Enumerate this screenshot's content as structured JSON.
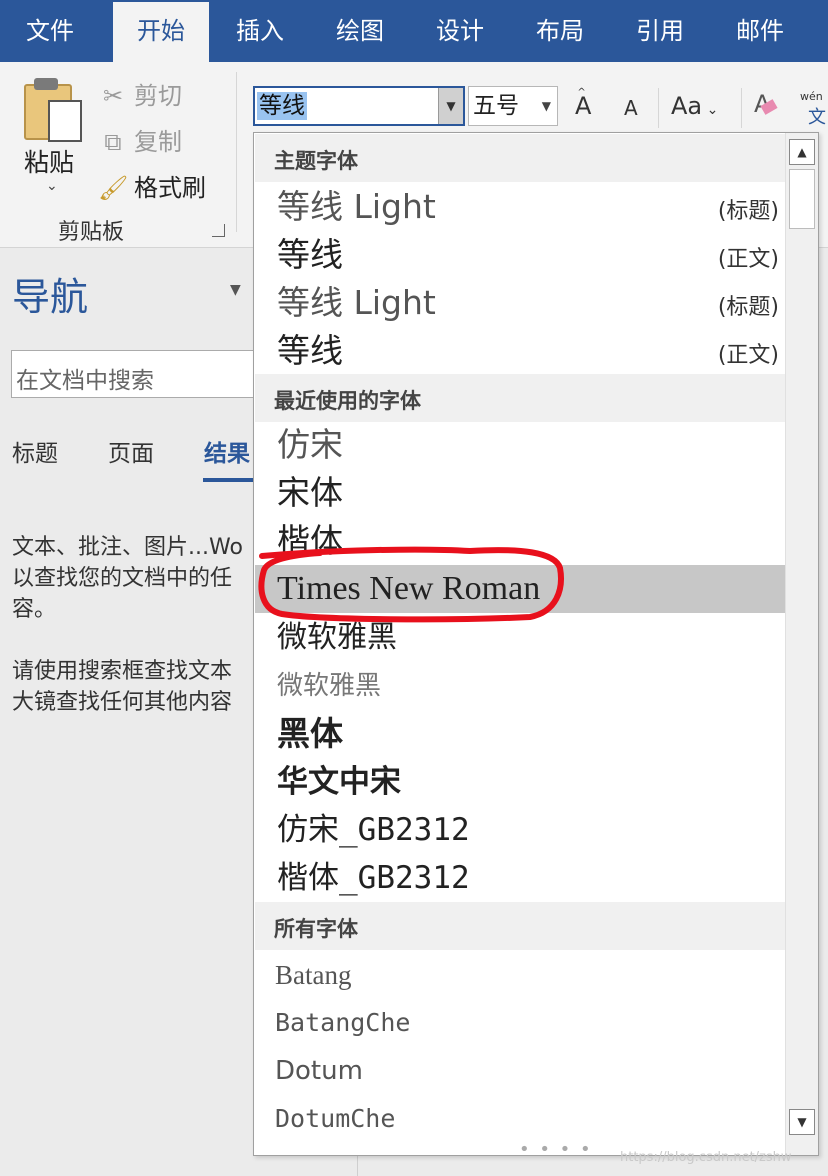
{
  "menu_tabs": [
    "文件",
    "开始",
    "插入",
    "绘图",
    "设计",
    "布局",
    "引用",
    "邮件"
  ],
  "active_tab": "开始",
  "ribbon": {
    "clipboard": {
      "paste_label": "粘贴",
      "cut_label": "剪切",
      "copy_label": "复制",
      "format_painter_label": "格式刷",
      "group_label": "剪贴板"
    },
    "font": {
      "font_name_value": "等线",
      "font_size_value": "五号",
      "grow_font": "A",
      "shrink_font": "A",
      "change_case": "Aa",
      "phonetic_top": "wén",
      "phonetic_char": "文"
    }
  },
  "navigation": {
    "title": "导航",
    "search_placeholder": "在文档中搜索",
    "tabs": [
      "标题",
      "页面",
      "结果"
    ],
    "active_tab": "结果",
    "paragraph1": [
      "文本、批注、图片...Wo",
      "以查找您的文档中的任",
      "容。"
    ],
    "paragraph2": [
      "请使用搜索框查找文本",
      "大镜查找任何其他内容"
    ]
  },
  "font_dropdown": {
    "sections": [
      {
        "header": "主题字体",
        "items": [
          {
            "name": "等线 Light",
            "tag": "(标题)"
          },
          {
            "name": "等线",
            "tag": "(正文)"
          },
          {
            "name": "等线 Light",
            "tag": "(标题)"
          },
          {
            "name": "等线",
            "tag": "(正文)"
          }
        ]
      },
      {
        "header": "最近使用的字体",
        "items": [
          {
            "name": "仿宋"
          },
          {
            "name": "宋体"
          },
          {
            "name": "楷体"
          },
          {
            "name": "Times New Roman",
            "highlighted": true
          },
          {
            "name": "微软雅黑"
          },
          {
            "name": "微软雅黑"
          },
          {
            "name": "黑体"
          },
          {
            "name": "华文中宋"
          },
          {
            "name": "仿宋_GB2312"
          },
          {
            "name": "楷体_GB2312"
          }
        ]
      },
      {
        "header": "所有字体",
        "items": [
          {
            "name": "Batang"
          },
          {
            "name": "BatangChe"
          },
          {
            "name": "Dotum"
          },
          {
            "name": "DotumChe"
          }
        ]
      }
    ],
    "scroll_up": "▲",
    "scroll_down": "▼"
  },
  "annotation": {
    "color": "#e8101c",
    "shape": "hand-drawn ellipse around Times New Roman"
  },
  "colors": {
    "accent": "#2b579a",
    "highlight_row": "#c7c7c7",
    "selection": "#99c3f0"
  },
  "watermark": "https://blog.csdn.net/zshw"
}
